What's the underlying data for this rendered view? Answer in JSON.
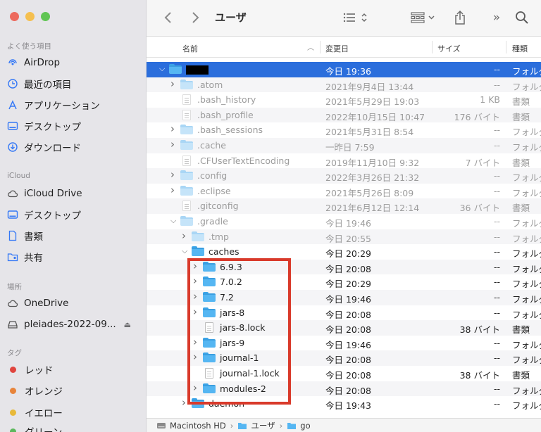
{
  "window": {
    "title": "ユーザ"
  },
  "sidebar": {
    "favorites_title": "よく使う項目",
    "favorites": [
      {
        "label": "AirDrop",
        "icon": "airdrop-icon"
      },
      {
        "label": "最近の項目",
        "icon": "clock-icon"
      },
      {
        "label": "アプリケーション",
        "icon": "applications-icon"
      },
      {
        "label": "デスクトップ",
        "icon": "desktop-icon"
      },
      {
        "label": "ダウンロード",
        "icon": "download-icon"
      }
    ],
    "icloud_title": "iCloud",
    "icloud": [
      {
        "label": "iCloud Drive",
        "icon": "cloud-icon"
      },
      {
        "label": "デスクトップ",
        "icon": "desktop-icon"
      },
      {
        "label": "書類",
        "icon": "document-icon"
      },
      {
        "label": "共有",
        "icon": "shared-folder-icon"
      }
    ],
    "locations_title": "場所",
    "locations": [
      {
        "label": "OneDrive",
        "icon": "cloud-icon"
      },
      {
        "label": "pleiades-2022-09...",
        "icon": "disk-icon"
      }
    ],
    "tags_title": "タグ",
    "tags": [
      {
        "label": "レッド",
        "color": "#e0443e"
      },
      {
        "label": "オレンジ",
        "color": "#e8843a"
      },
      {
        "label": "イエロー",
        "color": "#e8b93a"
      },
      {
        "label": "グリーン",
        "color": "#5cb85c"
      }
    ]
  },
  "columns": {
    "name": "名前",
    "date": "変更日",
    "size": "サイズ",
    "kind": "種類"
  },
  "files": [
    {
      "name": "",
      "date": "今日 19:36",
      "size": "--",
      "kind": "フォルダ",
      "type": "folder",
      "chevron": "open",
      "indent": 0,
      "selected": true,
      "redacted": true
    },
    {
      "name": ".atom",
      "date": "2021年9月4日 13:44",
      "size": "--",
      "kind": "フォルダ",
      "type": "folder",
      "chevron": "closed",
      "indent": 1,
      "dim": true
    },
    {
      "name": ".bash_history",
      "date": "2021年5月29日 19:03",
      "size": "1 KB",
      "kind": "書類",
      "type": "file",
      "chevron": "",
      "indent": 1,
      "dim": true
    },
    {
      "name": ".bash_profile",
      "date": "2022年10月15日 10:47",
      "size": "176 バイト",
      "kind": "書類",
      "type": "file",
      "chevron": "",
      "indent": 1,
      "dim": true
    },
    {
      "name": ".bash_sessions",
      "date": "2021年5月31日 8:54",
      "size": "--",
      "kind": "フォルダ",
      "type": "folder",
      "chevron": "closed",
      "indent": 1,
      "dim": true
    },
    {
      "name": ".cache",
      "date": "一昨日 7:59",
      "size": "--",
      "kind": "フォルダ",
      "type": "folder",
      "chevron": "closed",
      "indent": 1,
      "dim": true
    },
    {
      "name": ".CFUserTextEncoding",
      "date": "2019年11月10日 9:32",
      "size": "7 バイト",
      "kind": "書類",
      "type": "file",
      "chevron": "",
      "indent": 1,
      "dim": true
    },
    {
      "name": ".config",
      "date": "2022年3月26日 21:32",
      "size": "--",
      "kind": "フォルダ",
      "type": "folder",
      "chevron": "closed",
      "indent": 1,
      "dim": true
    },
    {
      "name": ".eclipse",
      "date": "2021年5月26日 8:09",
      "size": "--",
      "kind": "フォルダ",
      "type": "folder",
      "chevron": "closed",
      "indent": 1,
      "dim": true
    },
    {
      "name": ".gitconfig",
      "date": "2021年6月12日 12:14",
      "size": "36 バイト",
      "kind": "書類",
      "type": "file",
      "chevron": "",
      "indent": 1,
      "dim": true
    },
    {
      "name": ".gradle",
      "date": "今日 19:46",
      "size": "--",
      "kind": "フォルダ",
      "type": "folder",
      "chevron": "open",
      "indent": 1,
      "dim": true
    },
    {
      "name": ".tmp",
      "date": "今日 20:55",
      "size": "--",
      "kind": "フォルダ",
      "type": "folder",
      "chevron": "closed",
      "indent": 2,
      "dim": true
    },
    {
      "name": "caches",
      "date": "今日 20:29",
      "size": "--",
      "kind": "フォルダ",
      "type": "folder",
      "chevron": "open",
      "indent": 2
    },
    {
      "name": "6.9.3",
      "date": "今日 20:08",
      "size": "--",
      "kind": "フォルダ",
      "type": "folder",
      "chevron": "closed",
      "indent": 3
    },
    {
      "name": "7.0.2",
      "date": "今日 20:29",
      "size": "--",
      "kind": "フォルダ",
      "type": "folder",
      "chevron": "closed",
      "indent": 3
    },
    {
      "name": "7.2",
      "date": "今日 19:46",
      "size": "--",
      "kind": "フォルダ",
      "type": "folder",
      "chevron": "closed",
      "indent": 3
    },
    {
      "name": "jars-8",
      "date": "今日 20:08",
      "size": "--",
      "kind": "フォルダ",
      "type": "folder",
      "chevron": "closed",
      "indent": 3
    },
    {
      "name": "jars-8.lock",
      "date": "今日 20:08",
      "size": "38 バイト",
      "kind": "書類",
      "type": "file",
      "chevron": "",
      "indent": 3
    },
    {
      "name": "jars-9",
      "date": "今日 19:46",
      "size": "--",
      "kind": "フォルダ",
      "type": "folder",
      "chevron": "closed",
      "indent": 3
    },
    {
      "name": "journal-1",
      "date": "今日 20:08",
      "size": "--",
      "kind": "フォルダ",
      "type": "folder",
      "chevron": "closed",
      "indent": 3
    },
    {
      "name": "journal-1.lock",
      "date": "今日 20:08",
      "size": "38 バイト",
      "kind": "書類",
      "type": "file",
      "chevron": "",
      "indent": 3
    },
    {
      "name": "modules-2",
      "date": "今日 20:08",
      "size": "--",
      "kind": "フォルダ",
      "type": "folder",
      "chevron": "closed",
      "indent": 3
    },
    {
      "name": "daemon",
      "date": "今日 19:43",
      "size": "--",
      "kind": "フォルダ",
      "type": "folder",
      "chevron": "closed",
      "indent": 2
    }
  ],
  "pathbar": {
    "items": [
      "Macintosh HD",
      "ユーザ",
      "go"
    ]
  },
  "colors": {
    "selection": "#2b6edc",
    "highlight_box": "#d93a2b",
    "folder": "#55b6f2"
  }
}
